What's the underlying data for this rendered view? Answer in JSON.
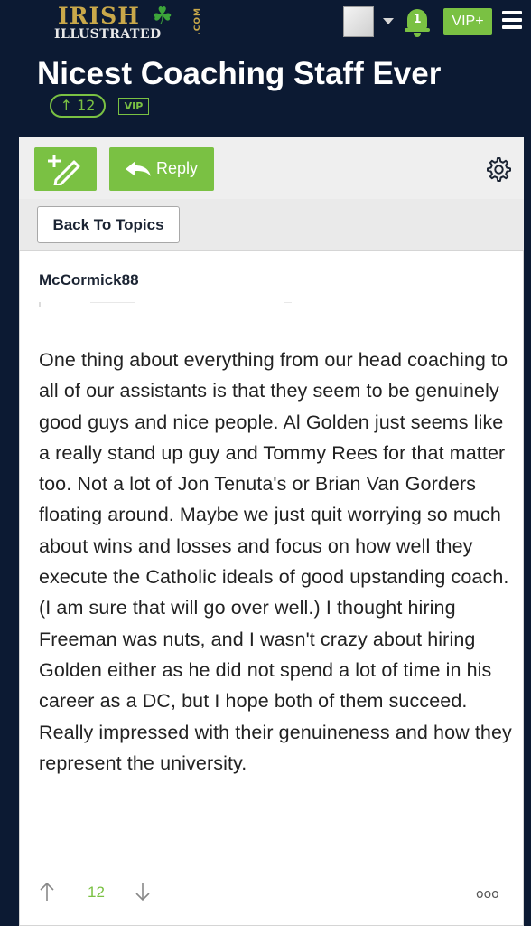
{
  "header": {
    "logo_line1": "IRISH",
    "logo_line2": "ILLUSTRATED",
    "logo_com": ".COM",
    "notification_count": "1",
    "vip_label": "VIP+"
  },
  "topic": {
    "title": "Nicest Coaching Staff Ever",
    "upvotes": "12",
    "vip_tag": "VIP"
  },
  "toolbar": {
    "reply_label": "Reply"
  },
  "nav": {
    "back_label": "Back To Topics"
  },
  "post": {
    "author": "McCormick88",
    "body": "One thing about everything from our head coaching to all of our assistants is that they seem to be genuinely good guys and nice people. Al Golden just seems like a really stand up guy and Tommy Rees for that matter too. Not a lot of Jon Tenuta's or Brian Van Gorders floating around. Maybe we just quit worrying so much about wins and losses and focus on how well they execute the Catholic ideals of good upstanding coach. (I am sure that will go over well.) I thought hiring Freeman was nuts, and I wasn't crazy about hiring Golden either as he did not spend a lot of time in his career as a DC, but I hope both of them succeed. Really impressed with their genuineness and how they represent the university.",
    "vote_count": "12",
    "more_label": "ooo"
  },
  "colors": {
    "navy": "#0c1a33",
    "green": "#7ac143",
    "gold": "#c9a84a"
  },
  "icons": [
    "clover-icon",
    "avatar",
    "caret-down-icon",
    "bell-icon",
    "hamburger-icon",
    "new-post-icon",
    "reply-arrow-icon",
    "gear-icon",
    "up-arrow-icon",
    "down-arrow-icon",
    "more-icon"
  ]
}
